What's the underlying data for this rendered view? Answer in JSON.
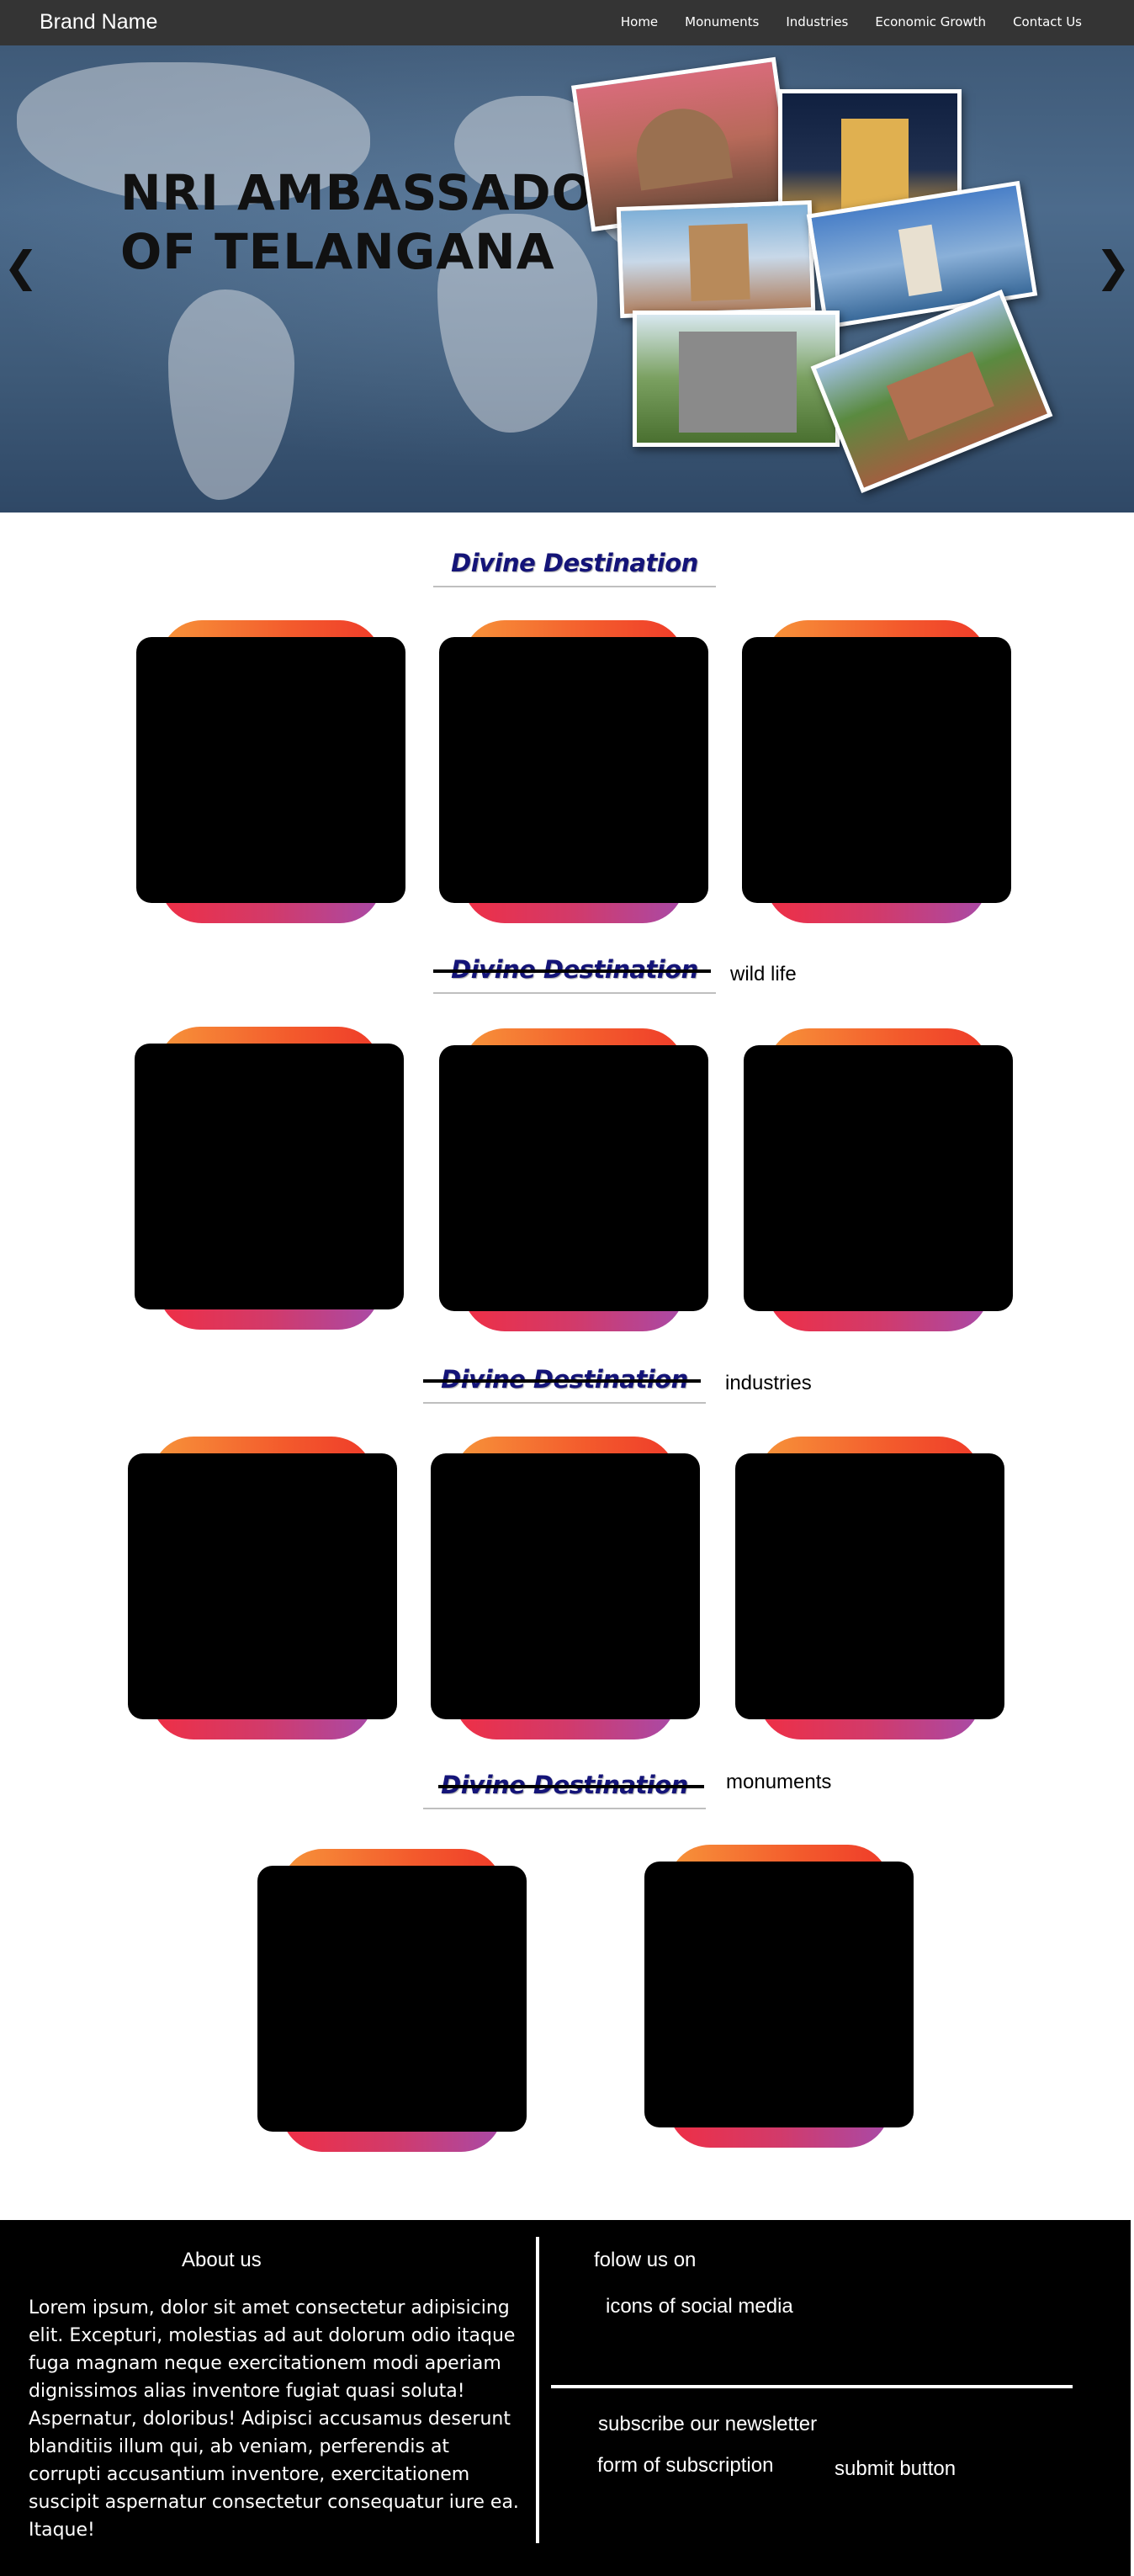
{
  "navbar": {
    "brand": "Brand Name",
    "links": [
      "Home",
      "Monuments",
      "Industries",
      "Economic Growth",
      "Contact Us"
    ]
  },
  "hero": {
    "title_line1": "NRI AMBASSADOR",
    "title_line2": "OF TELANGANA",
    "prev_arrow": "❮",
    "next_arrow": "❯"
  },
  "sections": [
    {
      "title": "Divine Destination",
      "side_label": ""
    },
    {
      "title": "Divine Destination",
      "side_label": "wild life"
    },
    {
      "title": "Divine Destination",
      "side_label": "industries"
    },
    {
      "title": "Divine Destination",
      "side_label": "monuments"
    }
  ],
  "footer": {
    "about_title": "About us",
    "about_text": "Lorem ipsum, dolor sit amet consectetur adipisicing elit. Excepturi, molestias ad aut dolorum odio itaque fuga magnam neque exercitationem modi aperiam dignissimos alias inventore fugiat quasi soluta! Aspernatur, doloribus! Adipisci accusamus deserunt blanditiis illum qui, ab veniam, perferendis at corrupti accusantium inventore, exercitationem suscipit aspernatur consectetur consequatur iure ea. Itaque!",
    "follow_title": "folow us on",
    "social_placeholder": "icons of social media",
    "subscribe_title": "subscribe our newsletter",
    "form_placeholder": "form of subscription",
    "submit_label": "submit button"
  },
  "colors": {
    "navbar_bg": "#343434",
    "heading_color": "#141478",
    "card_top_gradient": [
      "#f7943a",
      "#ef3b2a"
    ],
    "card_bottom_gradient": [
      "#ef2f45",
      "#a84aa8"
    ],
    "footer_bg": "#000000"
  }
}
